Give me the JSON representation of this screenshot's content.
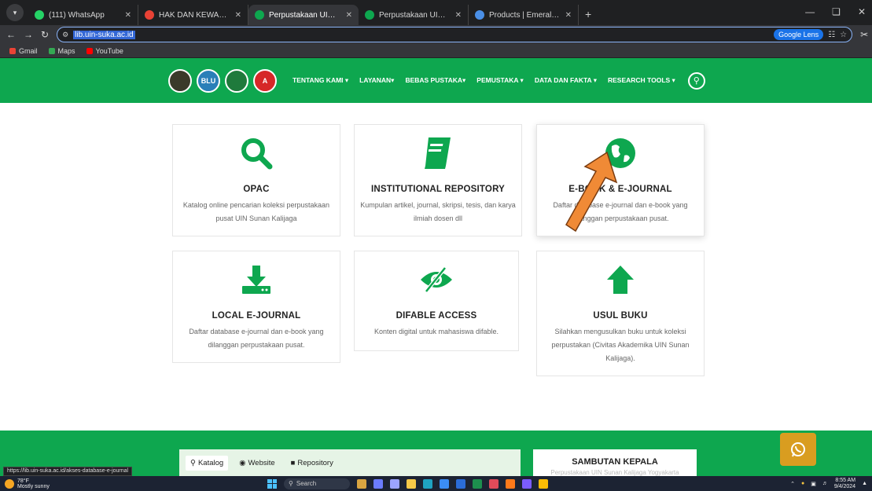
{
  "browser": {
    "tabs": [
      {
        "title": "(111) WhatsApp",
        "color": "#25d366"
      },
      {
        "title": "HAK DAN KEWAJIBAN ISTRI DA",
        "color": "#e94235"
      },
      {
        "title": "Perpustakaan UIN Sunan Kalija",
        "color": "#0ea74f"
      },
      {
        "title": "Perpustakaan UIN Sunan Kalija",
        "color": "#0ea74f"
      },
      {
        "title": "Products | Emerald Insight",
        "color": "#4a8fe7"
      }
    ],
    "url": "lib.uin-suka.ac.id",
    "google_lens": "Google Lens",
    "bookmarks": [
      {
        "label": "Gmail",
        "color": "#ea4335"
      },
      {
        "label": "Maps",
        "color": "#34a853"
      },
      {
        "label": "YouTube",
        "color": "#ff0000"
      }
    ]
  },
  "site": {
    "logos": [
      "",
      "BLU",
      "",
      "A"
    ],
    "nav": [
      "TENTANG KAMI ▾",
      "LAYANAN▾",
      "BEBAS PUSTAKA▾",
      "PEMUSTAKA ▾",
      "DATA DAN FAKTA ▾",
      "RESEARCH TOOLS ▾"
    ],
    "accent": "#0ea74f"
  },
  "cards": [
    {
      "title": "OPAC",
      "desc": "Katalog online pencarian koleksi perpustakaan pusat UIN Sunan Kalijaga"
    },
    {
      "title": "INSTITUTIONAL REPOSITORY",
      "desc": "Kumpulan artikel, journal, skripsi, tesis, dan karya ilmiah dosen dll"
    },
    {
      "title": "E-BOOK & E-JOURNAL",
      "desc": "Daftar database e-journal dan e-book yang dilanggan perpustakaan pusat."
    },
    {
      "title": "LOCAL E-JOURNAL",
      "desc": "Daftar database e-journal dan e-book yang dilanggan perpustakaan pusat."
    },
    {
      "title": "DIFABLE ACCESS",
      "desc": "Konten digital untuk mahasiswa difable."
    },
    {
      "title": "USUL BUKU",
      "desc": "Silahkan mengusulkan buku untuk koleksi perpustakan (Civitas Akademika UIN Sunan Kalijaga)."
    }
  ],
  "footer": {
    "tabs": [
      "Katalog",
      "Website",
      "Repository"
    ],
    "sambutan_title": "SAMBUTAN KEPALA",
    "sambutan_sub": "Perpustakaan UIN Sunan Kalijaga Yogyakarta"
  },
  "status_url": "https://lib.uin-suka.ac.id/akses-database-e-journal",
  "taskbar": {
    "temp": "78°F",
    "weather": "Mostly sunny",
    "search": "Search",
    "time": "8:55 AM",
    "date": "9/4/2024"
  }
}
